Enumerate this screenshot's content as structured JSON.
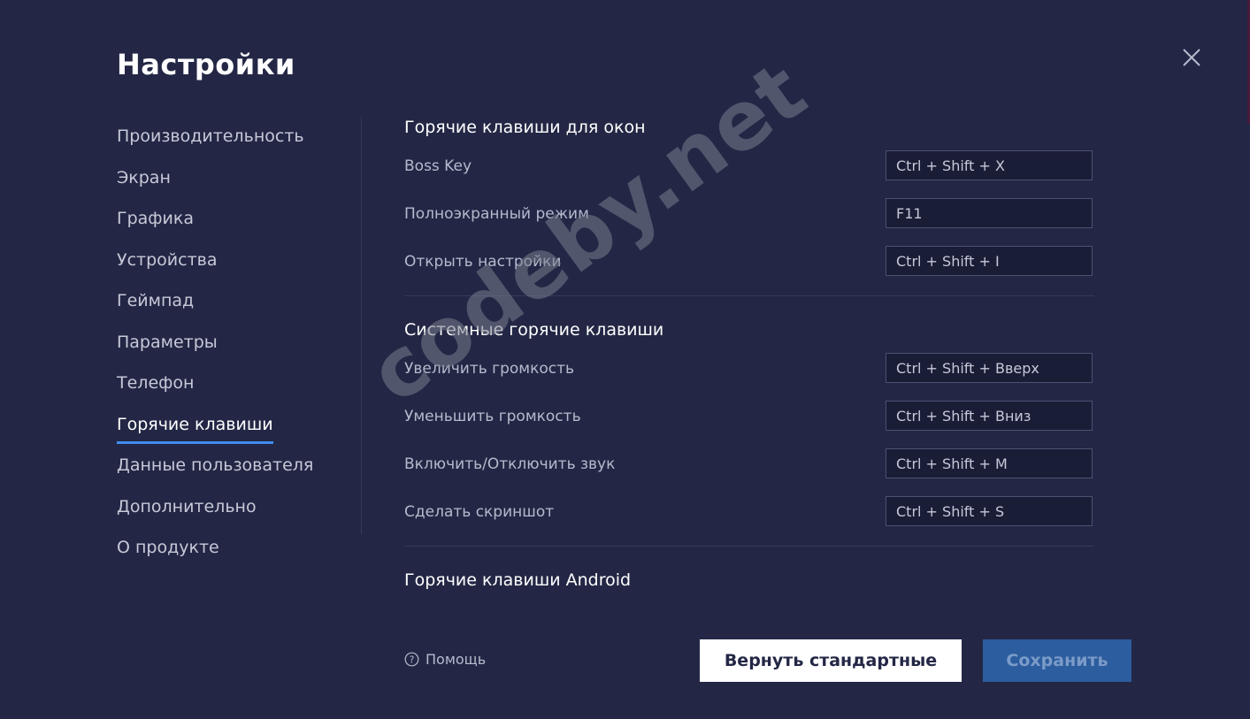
{
  "title": "Настройки",
  "sidebar": {
    "items": [
      {
        "label": "Производительность",
        "active": false
      },
      {
        "label": "Экран",
        "active": false
      },
      {
        "label": "Графика",
        "active": false
      },
      {
        "label": "Устройства",
        "active": false
      },
      {
        "label": "Геймпад",
        "active": false
      },
      {
        "label": "Параметры",
        "active": false
      },
      {
        "label": "Телефон",
        "active": false
      },
      {
        "label": "Горячие клавиши",
        "active": true
      },
      {
        "label": "Данные пользователя",
        "active": false
      },
      {
        "label": "Дополнительно",
        "active": false
      },
      {
        "label": "О продукте",
        "active": false
      }
    ]
  },
  "sections": [
    {
      "title": "Горячие клавиши для окон",
      "rows": [
        {
          "label": "Boss Key",
          "value": "Ctrl + Shift + X"
        },
        {
          "label": "Полноэкранный режим",
          "value": "F11"
        },
        {
          "label": "Открыть настройки",
          "value": "Ctrl + Shift + I"
        }
      ]
    },
    {
      "title": "Системные горячие клавиши",
      "rows": [
        {
          "label": "Увеличить громкость",
          "value": "Ctrl + Shift + Вверх"
        },
        {
          "label": "Уменьшить громкость",
          "value": "Ctrl + Shift + Вниз"
        },
        {
          "label": "Включить/Отключить звук",
          "value": "Ctrl + Shift + M"
        },
        {
          "label": "Сделать скриншот",
          "value": "Ctrl + Shift + S"
        }
      ]
    },
    {
      "title": "Горячие клавиши Android",
      "rows": []
    }
  ],
  "footer": {
    "help_label": "Помощь",
    "reset_label": "Вернуть стандартные",
    "save_label": "Сохранить"
  },
  "watermark": "codeby.net",
  "icons": {
    "close": "close-icon",
    "help": "question-circle-icon"
  },
  "colors": {
    "background": "#232745",
    "accent": "#3f8ef0",
    "save_button": "#2c5d9e"
  }
}
